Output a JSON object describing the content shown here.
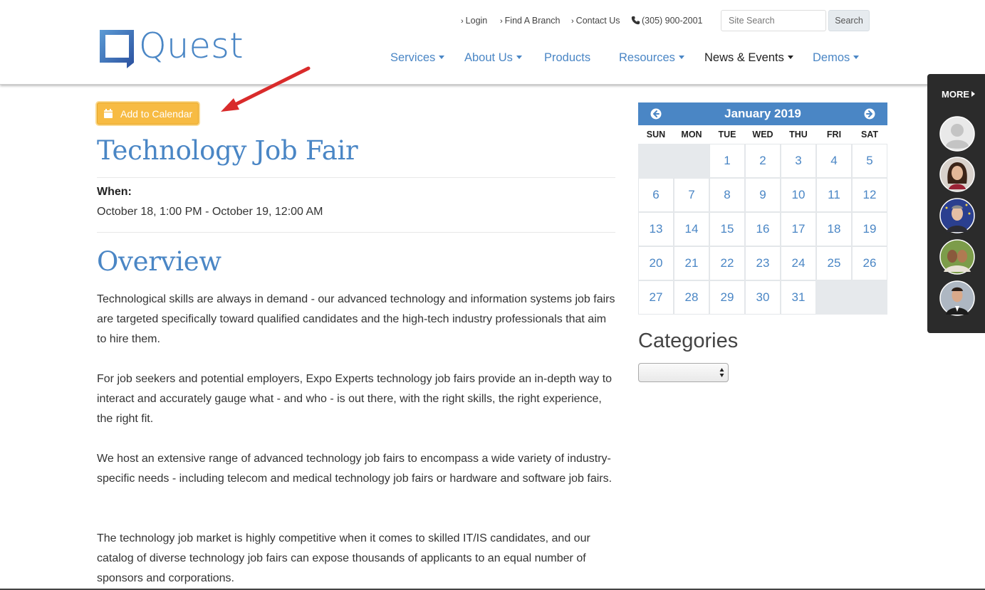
{
  "brand": {
    "name": "Quest",
    "primary_color": "#4a86c5",
    "accent_color": "#f7bb43",
    "dark_color": "#2b2b2b"
  },
  "utility_nav": {
    "login": "Login",
    "find_branch": "Find A Branch",
    "contact": "Contact Us",
    "phone": "(305) 900-2001",
    "search_placeholder": "Site Search",
    "search_button": "Search"
  },
  "main_nav": [
    {
      "label": "Services",
      "dropdown": true
    },
    {
      "label": "About Us",
      "dropdown": true
    },
    {
      "label": "Products",
      "dropdown": false
    },
    {
      "label": "Resources",
      "dropdown": true
    },
    {
      "label": "News & Events",
      "dropdown": true,
      "active": true
    },
    {
      "label": "Demos",
      "dropdown": true
    }
  ],
  "event": {
    "add_to_calendar": "Add to Calendar",
    "title": "Technology Job Fair",
    "when_label": "When:",
    "when_value": "October 18, 1:00 PM - October 19, 12:00 AM",
    "overview_heading": "Overview",
    "paragraphs": [
      "Technological skills are always in demand - our advanced technology and information systems job fairs are targeted specifically toward qualified candidates and the high-tech industry professionals that aim to hire them.",
      "For job seekers and potential employers, Expo Experts technology job fairs provide an in-depth way to interact and accurately gauge what - and who - is out there, with the right skills, the right experience, the right fit.",
      "We host an extensive range of advanced technology job fairs to encompass a wide variety of industry-specific needs - including telecom and medical technology job fairs or hardware and software job fairs.",
      "The technology job market is highly competitive when it comes to skilled IT/IS candidates, and our catalog of diverse technology job fairs can expose thousands of applicants to an equal number of sponsors and corporations."
    ]
  },
  "calendar": {
    "month_label": "January 2019",
    "weekdays": [
      "SUN",
      "MON",
      "TUE",
      "WED",
      "THU",
      "FRI",
      "SAT"
    ],
    "leading_blanks": 2,
    "days_in_month": 31,
    "trailing_blanks": 2
  },
  "sidebar": {
    "categories_heading": "Categories",
    "categories_selected": ""
  },
  "more_panel": {
    "label": "MORE",
    "avatars": [
      "default-user-avatar",
      "woman-avatar",
      "man-flag-avatar",
      "couple-avatar",
      "man-suit-avatar"
    ]
  }
}
